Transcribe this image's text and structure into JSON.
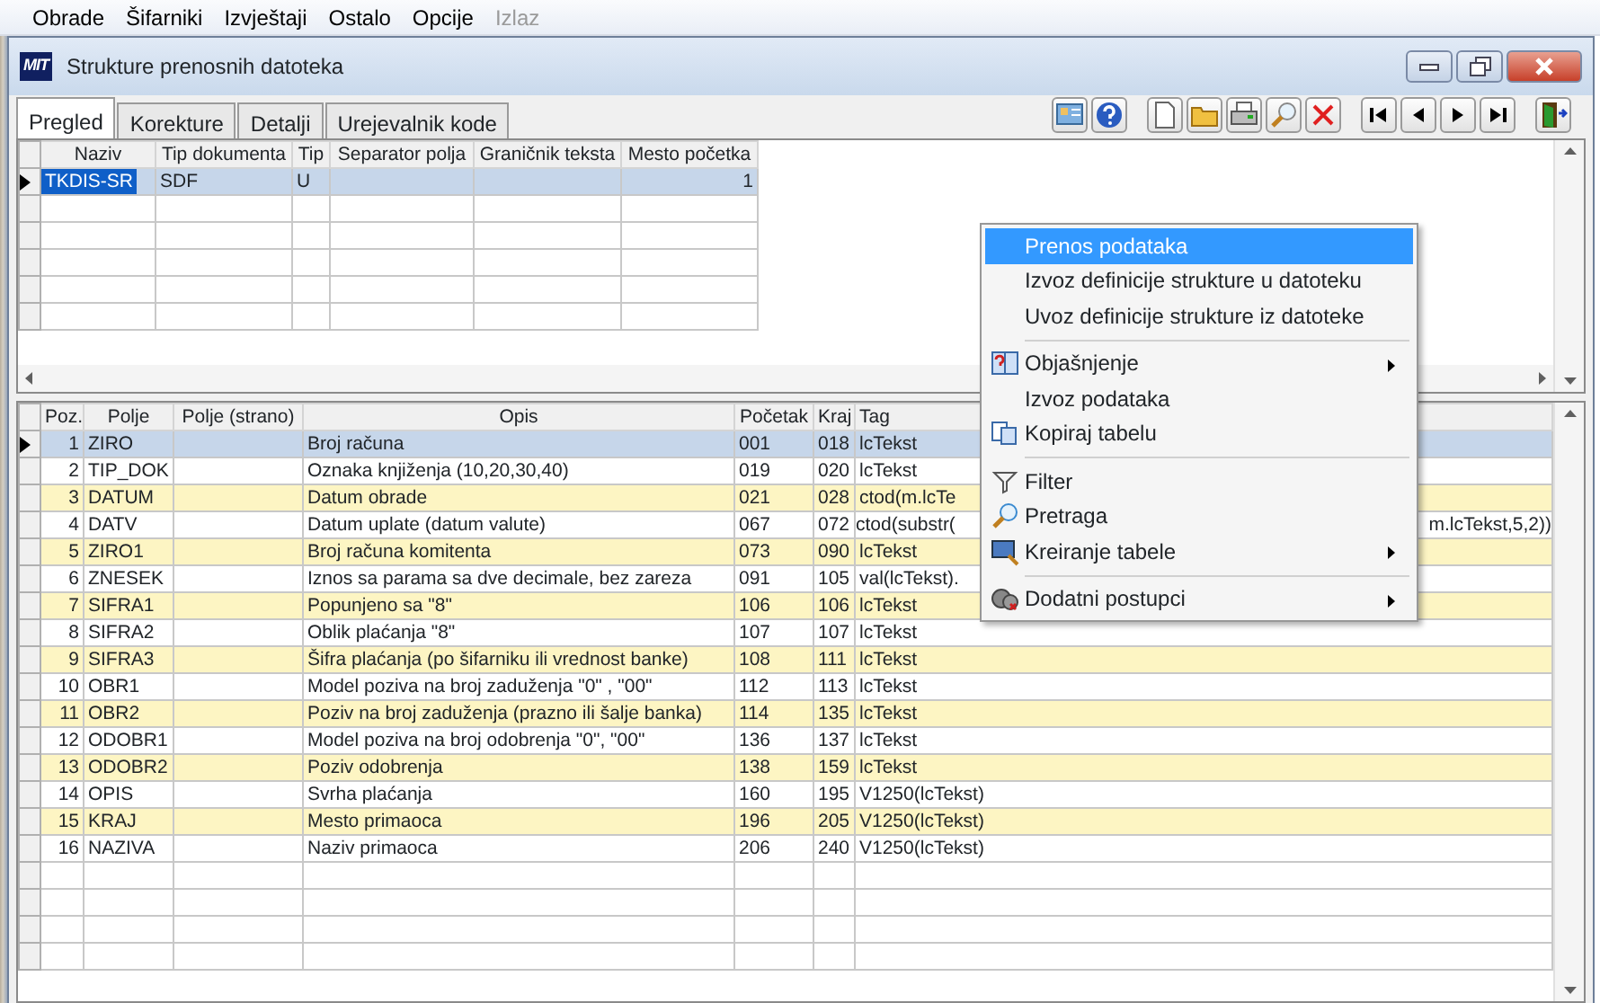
{
  "menubar": [
    {
      "label": "Obrade",
      "disabled": false
    },
    {
      "label": "Šifarniki",
      "disabled": false
    },
    {
      "label": "Izvještaji",
      "disabled": false
    },
    {
      "label": "Ostalo",
      "disabled": false
    },
    {
      "label": "Opcije",
      "disabled": false
    },
    {
      "label": "Izlaz",
      "disabled": true
    }
  ],
  "window": {
    "logo": "MIT",
    "title": "Strukture prenosnih datoteka"
  },
  "tabs": [
    {
      "label": "Pregled",
      "selected": true
    },
    {
      "label": "Korekture",
      "selected": false
    },
    {
      "label": "Detalji",
      "selected": false
    },
    {
      "label": "Urejevalnik kode",
      "selected": false
    }
  ],
  "toolbar": [
    {
      "kind": "card"
    },
    {
      "kind": "help"
    },
    {
      "kind": "gap"
    },
    {
      "kind": "new"
    },
    {
      "kind": "open"
    },
    {
      "kind": "print"
    },
    {
      "kind": "search"
    },
    {
      "kind": "delete"
    },
    {
      "kind": "gap"
    },
    {
      "kind": "first"
    },
    {
      "kind": "prev"
    },
    {
      "kind": "next"
    },
    {
      "kind": "last"
    },
    {
      "kind": "gap"
    },
    {
      "kind": "exit"
    }
  ],
  "upper_table": {
    "columns": [
      "Naziv",
      "Tip dokumenta",
      "Tip",
      "Separator polja",
      "Graničnik teksta",
      "Mesto početka"
    ],
    "rows": [
      {
        "cells": [
          "TKDIS-SR",
          "SDF",
          "U",
          "",
          "",
          "1"
        ],
        "selected": true
      }
    ]
  },
  "lower_table": {
    "columns": [
      "Poz.",
      "Polje",
      "Polje (strano)",
      "Opis",
      "Početak",
      "Kraj",
      "Tag"
    ],
    "rows": [
      {
        "cells": [
          "1",
          "ZIRO",
          "",
          "Broj računa",
          "001",
          "018",
          "lcTekst"
        ],
        "selected": true,
        "highlighted": false
      },
      {
        "cells": [
          "2",
          "TIP_DOK",
          "",
          "Oznaka knjiženja (10,20,30,40)",
          "019",
          "020",
          "lcTekst"
        ],
        "selected": false,
        "highlighted": false
      },
      {
        "cells": [
          "3",
          "DATUM",
          "",
          "Datum obrade",
          "021",
          "028",
          "ctod(m.lcTe"
        ],
        "selected": false,
        "highlighted": true
      },
      {
        "cells": [
          "4",
          "DATV",
          "",
          "Datum uplate (datum valute)",
          "067",
          "072",
          "ctod(substr("
        ],
        "tag_tail": "m.lcTekst,5,2))",
        "selected": false,
        "highlighted": false
      },
      {
        "cells": [
          "5",
          "ZIRO1",
          "",
          "Broj računa komitenta",
          "073",
          "090",
          "lcTekst"
        ],
        "selected": false,
        "highlighted": true
      },
      {
        "cells": [
          "6",
          "ZNESEK",
          "",
          "Iznos sa parama sa dve decimale, bez zareza",
          "091",
          "105",
          "val(lcTekst)."
        ],
        "selected": false,
        "highlighted": false
      },
      {
        "cells": [
          "7",
          "SIFRA1",
          "",
          "Popunjeno sa \"8\"",
          "106",
          "106",
          "lcTekst"
        ],
        "selected": false,
        "highlighted": true
      },
      {
        "cells": [
          "8",
          "SIFRA2",
          "",
          "Oblik plaćanja \"8\"",
          "107",
          "107",
          "lcTekst"
        ],
        "selected": false,
        "highlighted": false
      },
      {
        "cells": [
          "9",
          "SIFRA3",
          "",
          "Šifra plaćanja (po šifarniku ili vrednost banke)",
          "108",
          "111",
          "lcTekst"
        ],
        "selected": false,
        "highlighted": true
      },
      {
        "cells": [
          "10",
          "OBR1",
          "",
          "Model poziva na broj zaduženja \"0\" , \"00\"",
          "112",
          "113",
          "lcTekst"
        ],
        "selected": false,
        "highlighted": false
      },
      {
        "cells": [
          "11",
          "OBR2",
          "",
          "Poziv na broj zaduženja (prazno ili šalje banka)",
          "114",
          "135",
          "lcTekst"
        ],
        "selected": false,
        "highlighted": true
      },
      {
        "cells": [
          "12",
          "ODOBR1",
          "",
          "Model poziva na broj odobrenja \"0\", \"00\"",
          "136",
          "137",
          "lcTekst"
        ],
        "selected": false,
        "highlighted": false
      },
      {
        "cells": [
          "13",
          "ODOBR2",
          "",
          "Poziv odobrenja",
          "138",
          "159",
          "lcTekst"
        ],
        "selected": false,
        "highlighted": true
      },
      {
        "cells": [
          "14",
          "OPIS",
          "",
          "Svrha plaćanja",
          "160",
          "195",
          "V1250(lcTekst)"
        ],
        "selected": false,
        "highlighted": false
      },
      {
        "cells": [
          "15",
          "KRAJ",
          "",
          "Mesto primaoca",
          "196",
          "205",
          "V1250(lcTekst)"
        ],
        "selected": false,
        "highlighted": true
      },
      {
        "cells": [
          "16",
          "NAZIVA",
          "",
          "Naziv primaoca",
          "206",
          "240",
          "V1250(lcTekst)"
        ],
        "selected": false,
        "highlighted": false
      }
    ]
  },
  "context_menu": [
    {
      "kind": "item",
      "label": "Prenos podataka",
      "selected": true
    },
    {
      "kind": "item",
      "label": "Izvoz definicije strukture u datoteku",
      "selected": false
    },
    {
      "kind": "item",
      "label": "Uvoz definicije strukture iz datoteke",
      "selected": false
    },
    {
      "kind": "separator"
    },
    {
      "kind": "item",
      "label": "Objašnjenje",
      "submenu": true,
      "selected": false
    },
    {
      "kind": "item",
      "label": "Izvoz podataka",
      "selected": false
    },
    {
      "kind": "item",
      "label": "Kopiraj tabelu",
      "selected": false
    },
    {
      "kind": "separator"
    },
    {
      "kind": "item",
      "label": "Filter",
      "selected": false
    },
    {
      "kind": "item",
      "label": "Pretraga",
      "selected": false
    },
    {
      "kind": "item",
      "label": "Kreiranje tabele",
      "submenu": true,
      "selected": false
    },
    {
      "kind": "separator"
    },
    {
      "kind": "item",
      "label": "Dodatni postupci",
      "submenu": true,
      "selected": false
    }
  ]
}
